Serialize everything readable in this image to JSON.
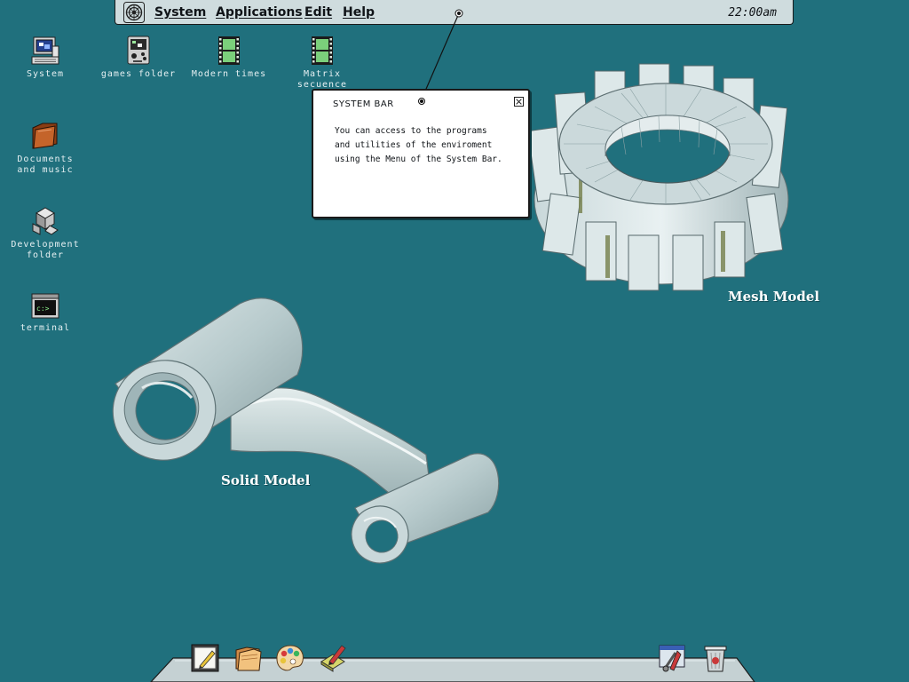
{
  "system_bar": {
    "menus": [
      "System",
      "Applications",
      "Edit",
      "Help"
    ],
    "clock": "22:00am"
  },
  "desktop_icons": [
    {
      "label": "System",
      "icon": "computer-icon"
    },
    {
      "label": "games folder",
      "icon": "games-folder-icon"
    },
    {
      "label": "Modern times",
      "icon": "film-icon"
    },
    {
      "label": "Matrix\nsecuence",
      "icon": "film-icon"
    },
    {
      "label": "Documents\nand music",
      "icon": "folder-icon"
    },
    {
      "label": "Development\nfolder",
      "icon": "development-icon"
    },
    {
      "label": "terminal",
      "icon": "terminal-icon"
    }
  ],
  "help_popup": {
    "title": "SYSTEM BAR",
    "lines": [
      "You can access to the programs",
      "and utilities of the enviroment",
      "using the Menu of the System Bar."
    ]
  },
  "models": {
    "mesh_label": "Mesh Model",
    "solid_label": "Solid Model"
  },
  "dock": {
    "icons": [
      "notepad-icon",
      "folders-icon",
      "paint-palette-icon",
      "draw-icon",
      "tools-icon",
      "trash-icon"
    ]
  },
  "colors": {
    "desktop": "#20707d",
    "bar": "#cfdcde",
    "model_gray": "#b7cacc"
  }
}
